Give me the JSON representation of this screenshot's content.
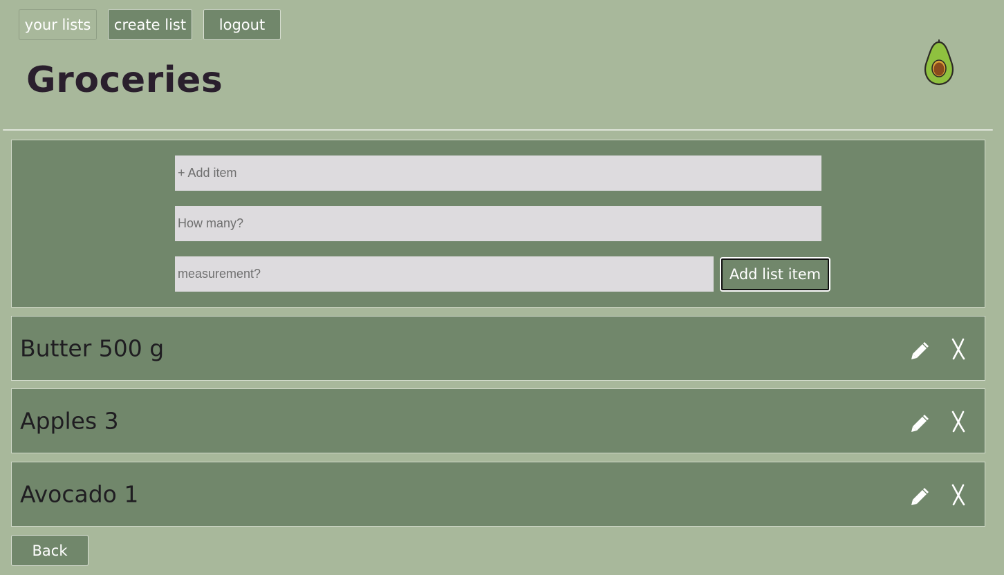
{
  "nav": {
    "your_lists": "your lists",
    "create_list": "create list",
    "logout": "logout"
  },
  "page": {
    "title": "Groceries",
    "logo_icon": "avocado-icon"
  },
  "form": {
    "item_placeholder": "+ Add item",
    "quantity_placeholder": "How many?",
    "measurement_placeholder": "measurement?",
    "submit_label": "Add list item"
  },
  "items": [
    {
      "label": "Butter 500 g",
      "edit_icon": "pencil-icon",
      "delete_icon": "cross-icon"
    },
    {
      "label": "Apples 3",
      "edit_icon": "pencil-icon",
      "delete_icon": "cross-icon"
    },
    {
      "label": "Avocado 1",
      "edit_icon": "pencil-icon",
      "delete_icon": "cross-icon"
    }
  ],
  "footer": {
    "back_label": "Back"
  },
  "colors": {
    "background": "#a8b89b",
    "panel": "#71876b",
    "input": "#dddbde",
    "title": "#2a1f2d"
  }
}
